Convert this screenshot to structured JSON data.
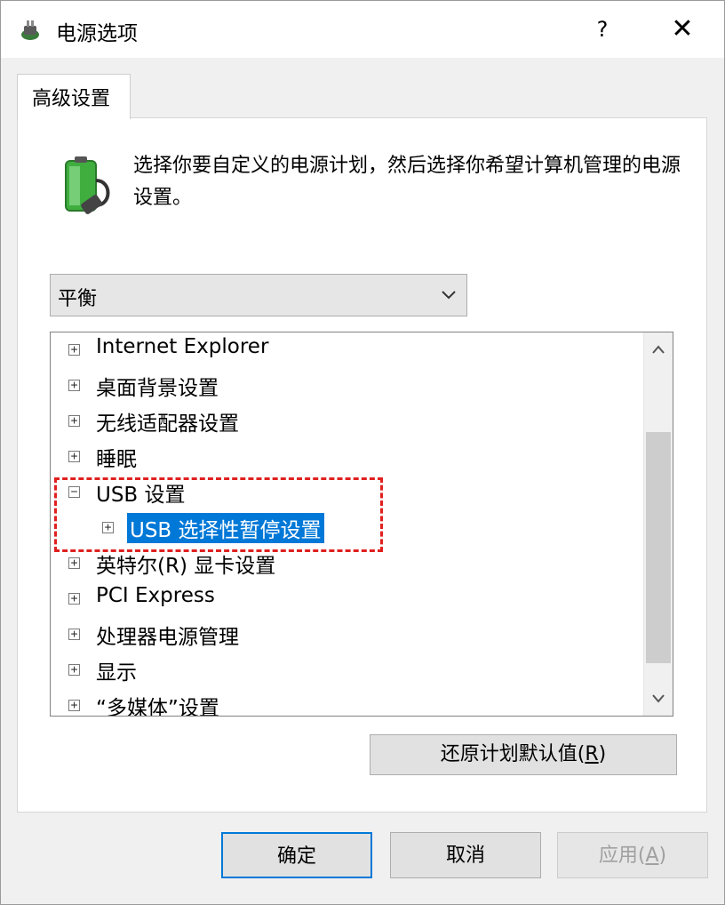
{
  "window": {
    "title": "电源选项",
    "help_label": "?",
    "close_label": "✕"
  },
  "tab": {
    "label": "高级设置"
  },
  "description": "选择你要自定义的电源计划，然后选择你希望计算机管理的电源设置。",
  "plan_select": {
    "value": "平衡"
  },
  "tree": {
    "items": [
      {
        "label": "Internet Explorer",
        "expander": "+"
      },
      {
        "label": "桌面背景设置",
        "expander": "+"
      },
      {
        "label": "无线适配器设置",
        "expander": "+"
      },
      {
        "label": "睡眠",
        "expander": "+"
      },
      {
        "label": "USB 设置",
        "expander": "−"
      },
      {
        "label": "USB 选择性暂停设置",
        "expander": "+",
        "selected": true
      },
      {
        "label": "英特尔(R) 显卡设置",
        "expander": "+"
      },
      {
        "label": "PCI Express",
        "expander": "+"
      },
      {
        "label": "处理器电源管理",
        "expander": "+"
      },
      {
        "label": "显示",
        "expander": "+"
      },
      {
        "label": "“多媒体”设置",
        "expander": "+"
      }
    ]
  },
  "restore_button": {
    "label": "还原计划默认值",
    "accel": "R"
  },
  "buttons": {
    "ok": "确定",
    "cancel": "取消",
    "apply": "应用",
    "apply_accel": "A"
  },
  "colors": {
    "selection": "#0078d7",
    "highlight_border": "#e02020"
  }
}
